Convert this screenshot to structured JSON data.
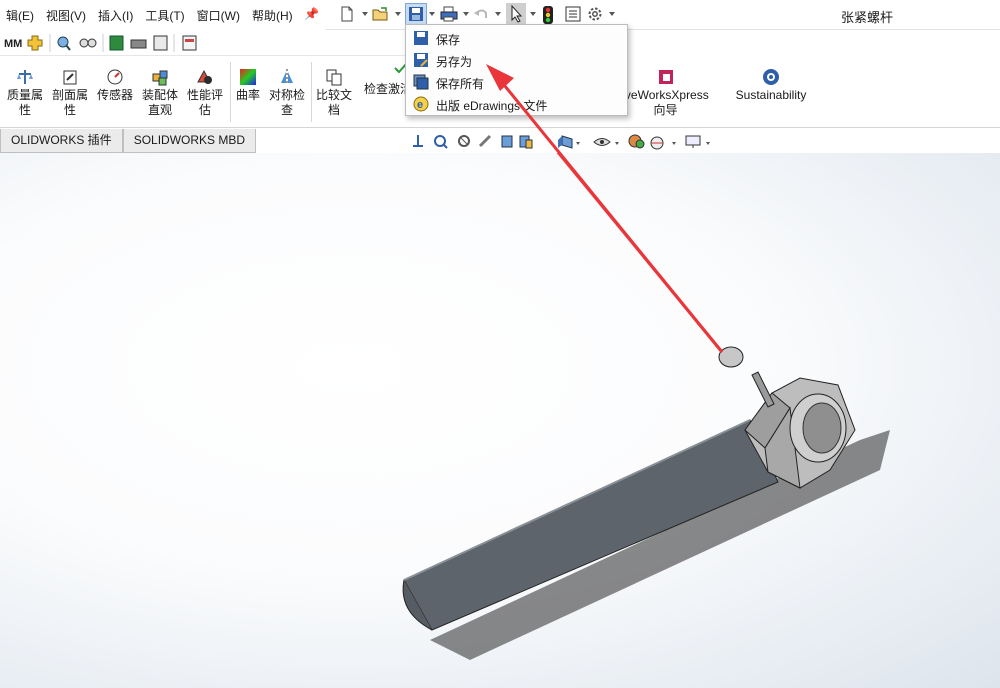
{
  "menubar": {
    "items": [
      "辑(E)",
      "视图(V)",
      "插入(I)",
      "工具(T)",
      "窗口(W)",
      "帮助(H)"
    ],
    "pin_icon": "pin-icon"
  },
  "quick_toolbar": {
    "icons": [
      "new-document-icon",
      "open-folder-icon",
      "save-icon",
      "print-icon",
      "undo-icon",
      "select-cursor-icon",
      "rebuild-traffic-light-icon",
      "file-properties-icon",
      "options-gear-icon"
    ],
    "document_title": "张紧螺杆"
  },
  "ribbon": {
    "buttons": [
      {
        "label_1": "质量属",
        "label_2": "性"
      },
      {
        "label_1": "剖面属",
        "label_2": "性"
      },
      {
        "label_1": "传感器",
        "label_2": ""
      },
      {
        "label_1": "装配体",
        "label_2": "直观"
      },
      {
        "label_1": "性能评",
        "label_2": "估"
      },
      {
        "label_1": "曲率",
        "label_2": ""
      },
      {
        "label_1": "对称检",
        "label_2": "查"
      },
      {
        "label_1": "比较文",
        "label_2": "档"
      },
      {
        "label_1": "检查激活",
        "label_2": ""
      },
      {
        "label_1": "iveWorksXpress",
        "label_2": "向导"
      },
      {
        "label_1": "Sustainability",
        "label_2": ""
      }
    ]
  },
  "tabs": [
    "OLIDWORKS 插件",
    "SOLIDWORKS MBD"
  ],
  "save_menu": {
    "items": [
      "保存",
      "另存为",
      "保存所有",
      "出版 eDrawings 文件"
    ]
  },
  "colors": {
    "arrow": "#e8363a",
    "model_body": "#5e646b",
    "nut": "#b9b9b9",
    "accent": "#2a6fc9"
  }
}
